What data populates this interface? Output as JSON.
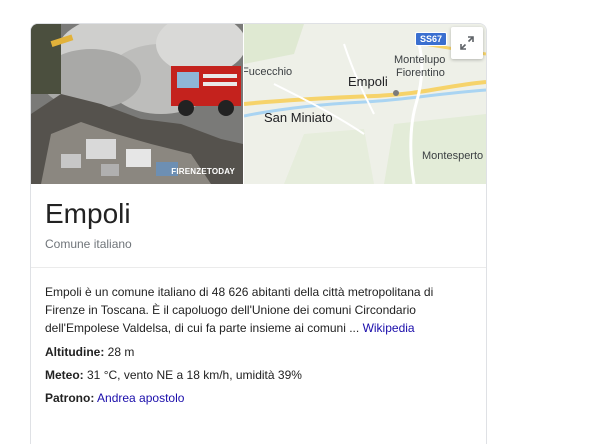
{
  "header": {
    "photo_watermark": "FIRENZETODAY",
    "map": {
      "labels": {
        "fucecchio": "Fucecchio",
        "empoli": "Empoli",
        "montelupo": "Montelupo",
        "fiorentino": "Fiorentino",
        "san_miniato": "San Miniato",
        "montespertoli": "Montesperto"
      },
      "road_shield": "SS67",
      "expand_icon": "expand-icon"
    }
  },
  "entity": {
    "title": "Empoli",
    "subtitle": "Comune italiano"
  },
  "description": {
    "text": "Empoli è un comune italiano di 48 626 abitanti della città metropolitana di Firenze in Toscana. È il capoluogo dell'Unione dei comuni Circondario dell'Empolese Valdelsa, di cui fa parte insieme ai comuni ... ",
    "source_link": "Wikipedia"
  },
  "facts": {
    "altitude": {
      "label": "Altitudine:",
      "value": " 28 m"
    },
    "weather": {
      "label": "Meteo:",
      "value": " 31 °C, vento NE a 18 km/h, umidità 39%"
    },
    "patron": {
      "label": "Patrono:",
      "value": "Andrea apostolo"
    }
  },
  "colors": {
    "link": "#1a0dab",
    "muted": "#70757a",
    "shield": "#3a6fd0",
    "road": "#f6d36a"
  }
}
